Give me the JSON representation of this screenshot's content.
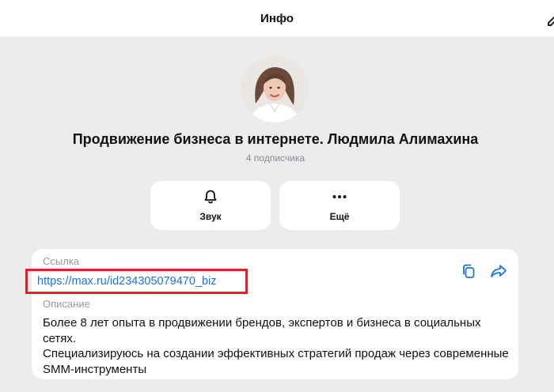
{
  "header": {
    "title": "Инфо"
  },
  "channel": {
    "name": "Продвижение бизнеса в интернете. Людмила Алимахина",
    "subscribers": "4 подписчика"
  },
  "actions": [
    {
      "label": "Звук",
      "icon": "bell-icon"
    },
    {
      "label": "Ещё",
      "icon": "more-dots-icon"
    }
  ],
  "info": {
    "link_label": "Ссылка",
    "link_url": "https://max.ru/id234305079470_biz",
    "description_label": "Описание",
    "description_lines": [
      "Более 8 лет опыта в продвижении брендов, экспертов и бизнеса в социальных сетях.",
      "Специализируюсь на создании эффективных стратегий продаж через современные SMM-инструменты"
    ]
  },
  "colors": {
    "accent": "#1a73e8",
    "highlight_border": "#e41f26",
    "background": "#ececef"
  }
}
